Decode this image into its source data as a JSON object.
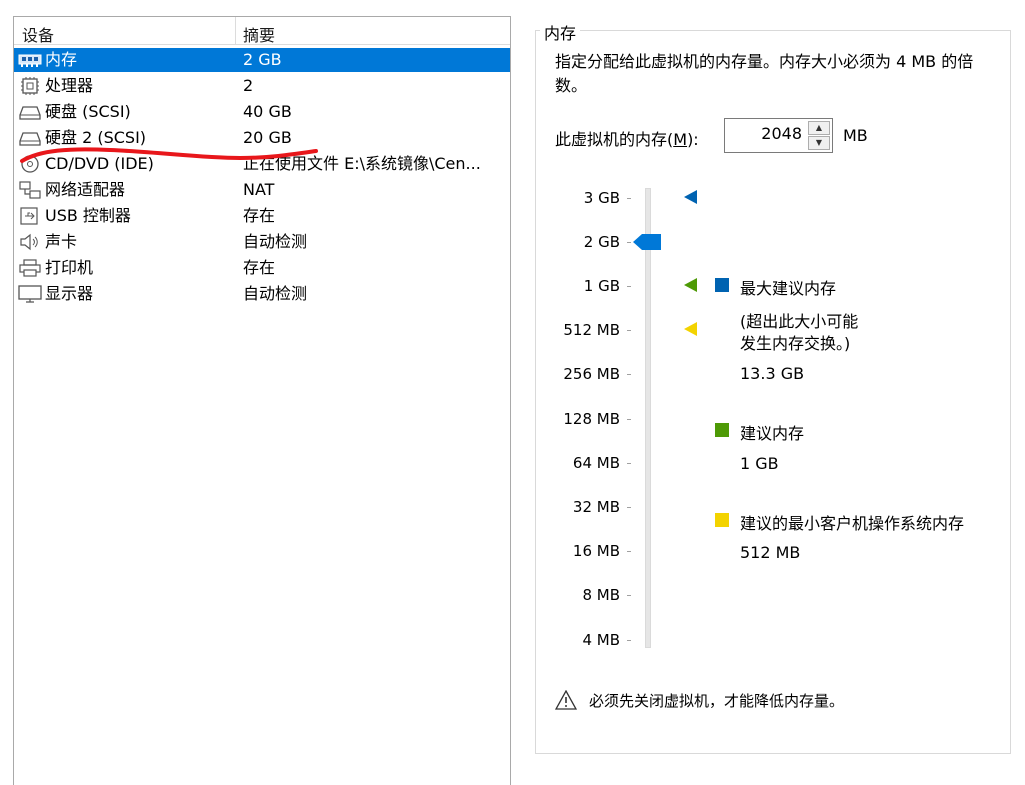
{
  "device_table": {
    "headers": {
      "device": "设备",
      "summary": "摘要"
    },
    "rows": [
      {
        "name": "内存",
        "summary": "2 GB",
        "icon": "memory-icon",
        "selected": true
      },
      {
        "name": "处理器",
        "summary": "2",
        "icon": "processor-icon",
        "selected": false
      },
      {
        "name": "硬盘 (SCSI)",
        "summary": "40 GB",
        "icon": "harddisk-icon",
        "selected": false
      },
      {
        "name": "硬盘 2 (SCSI)",
        "summary": "20 GB",
        "icon": "harddisk-icon",
        "selected": false
      },
      {
        "name": "CD/DVD (IDE)",
        "summary": "正在使用文件 E:\\系统镜像\\Cen...",
        "icon": "cd-dvd-icon",
        "selected": false
      },
      {
        "name": "网络适配器",
        "summary": "NAT",
        "icon": "network-adapter-icon",
        "selected": false
      },
      {
        "name": "USB 控制器",
        "summary": "存在",
        "icon": "usb-icon",
        "selected": false
      },
      {
        "name": "声卡",
        "summary": "自动检测",
        "icon": "speaker-icon",
        "selected": false
      },
      {
        "name": "打印机",
        "summary": "存在",
        "icon": "printer-icon",
        "selected": false
      },
      {
        "name": "显示器",
        "summary": "自动检测",
        "icon": "monitor-icon",
        "selected": false
      }
    ]
  },
  "memory": {
    "group_title": "内存",
    "description": "指定分配给此虚拟机的内存量。内存大小必须为 4 MB 的倍数。",
    "input_label_prefix": "此虚拟机的内存(",
    "input_label_key": "M",
    "input_label_suffix": "):",
    "value": "2048",
    "unit": "MB",
    "scale_labels": [
      "3 GB",
      "2 GB",
      "1 GB",
      "512 MB",
      "256 MB",
      "128 MB",
      "64 MB",
      "32 MB",
      "16 MB",
      "8 MB",
      "4 MB"
    ],
    "current_level": "2 GB",
    "legend": {
      "max_label": "最大建议内存",
      "max_note_line1": "(超出此大小可能",
      "max_note_line2": "发生内存交换。)",
      "max_value": "13.3 GB",
      "rec_label": "建议内存",
      "rec_value": "1 GB",
      "min_label": "建议的最小客户机操作系统内存",
      "min_value": "512 MB"
    },
    "warning": "必须先关闭虚拟机，才能降低内存量。"
  },
  "colors": {
    "selection": "#0078d7",
    "max_marker": "#0063b1",
    "recommended_marker": "#4e9a06",
    "minimum_marker": "#f3d300",
    "annotation": "#e8171b"
  }
}
